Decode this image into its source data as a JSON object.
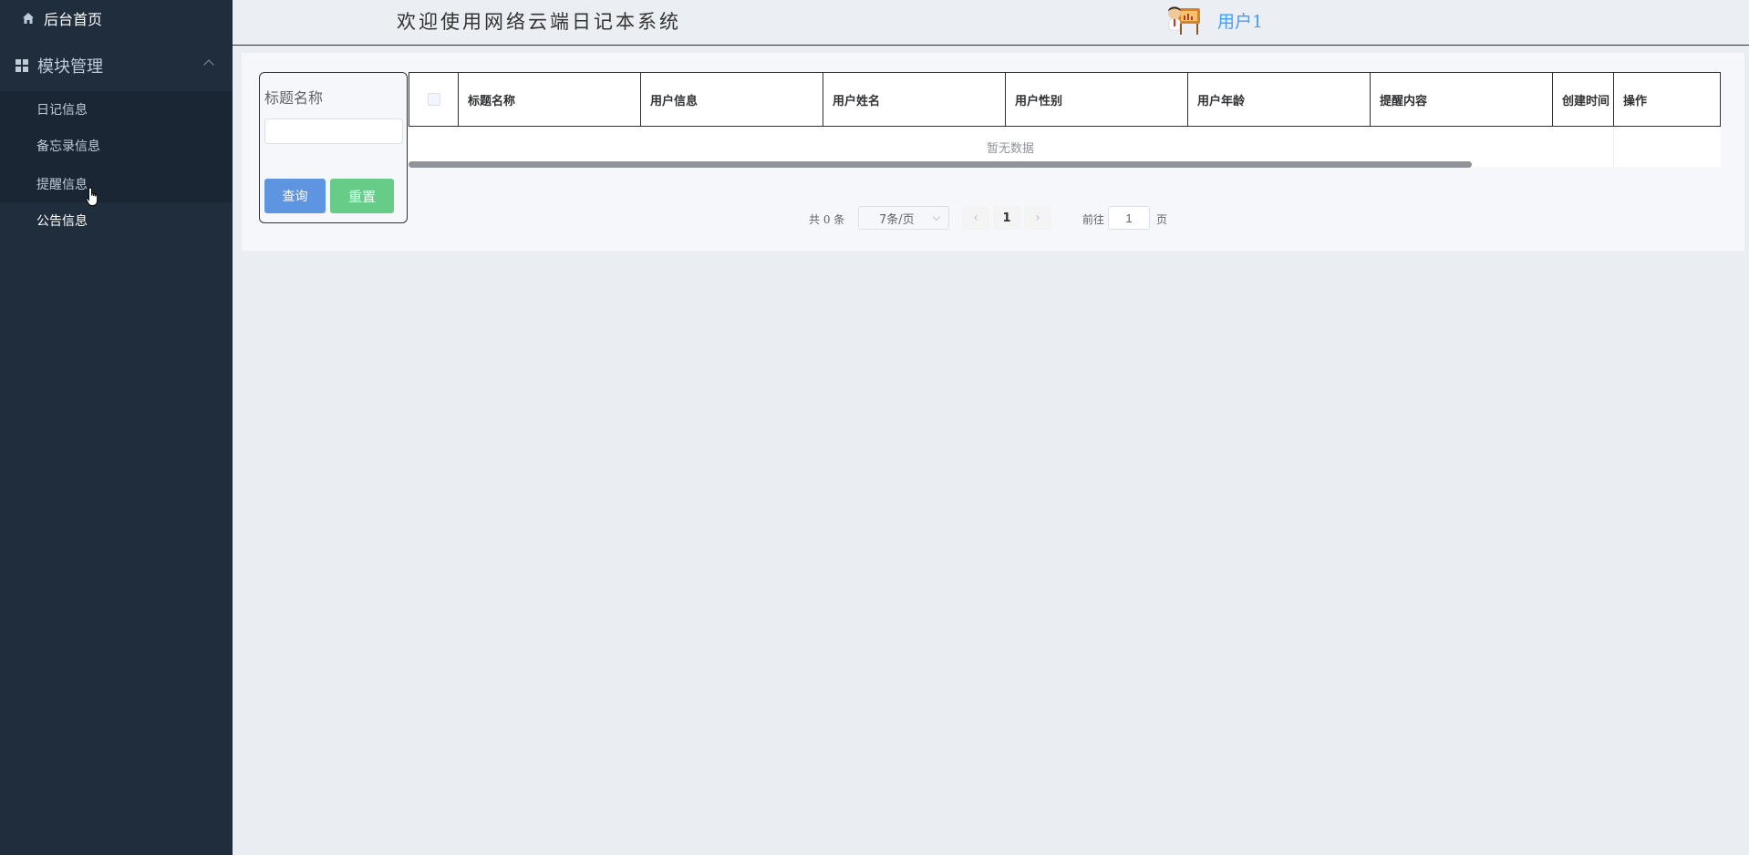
{
  "sidebar": {
    "home_label": "后台首页",
    "module_label": "模块管理",
    "items": [
      {
        "label": "日记信息"
      },
      {
        "label": "备忘录信息"
      },
      {
        "label": "提醒信息"
      },
      {
        "label": "公告信息"
      }
    ]
  },
  "header": {
    "title": "欢迎使用网络云端日记本系统",
    "username": "用户1"
  },
  "search": {
    "label": "标题名称",
    "value": "",
    "query_button": "查询",
    "reset_button": "重置"
  },
  "table": {
    "columns": [
      "标题名称",
      "用户信息",
      "用户姓名",
      "用户性别",
      "用户年龄",
      "提醒内容",
      "创建时间",
      "操作"
    ],
    "empty_text": "暂无数据"
  },
  "pagination": {
    "total_text": "共 0 条",
    "page_size": "7条/页",
    "current_page": "1",
    "goto_label": "前往",
    "goto_value": "1",
    "page_suffix": "页"
  },
  "colors": {
    "sidebar_bg": "#1f2d3d",
    "accent": "#409eff",
    "query_btn": "#5d95e1",
    "reset_btn": "#66cc88"
  }
}
